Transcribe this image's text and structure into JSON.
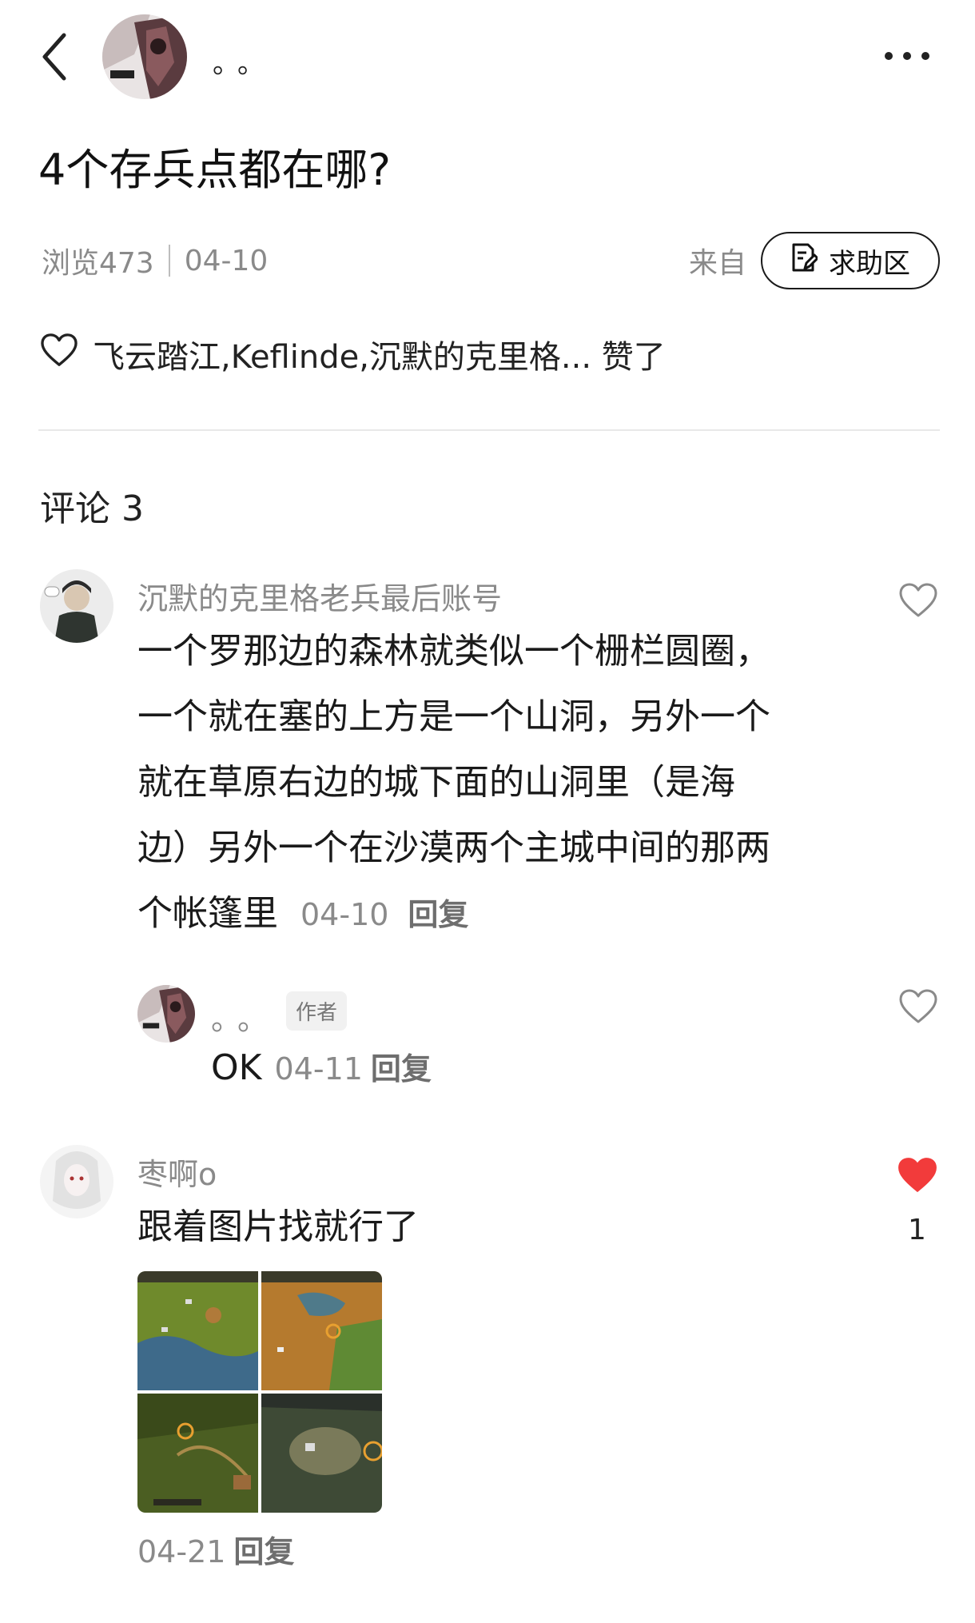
{
  "header": {
    "author_name": "。。"
  },
  "post": {
    "title": "4个存兵点都在哪?",
    "views": "浏览473",
    "date": "04-10",
    "from_label": "来自",
    "board": "求助区",
    "likes_text": "飞云踏江,Keflinde,沉默的克里格... 赞了"
  },
  "comments": {
    "title": "评论 3",
    "items": [
      {
        "name": "沉默的克里格老兵最后账号",
        "lines": [
          "一个罗那边的森林就类似一个栅栏圆圈，",
          "一个就在塞的上方是一个山洞，另外一个",
          "就在草原右边的城下面的山洞里（是海",
          "边）另外一个在沙漠两个主城中间的那两",
          "个帐篷里"
        ],
        "time": "04-10",
        "reply": "回复"
      },
      {
        "name": "。。",
        "badge": "作者",
        "text": "OK",
        "time": "04-11",
        "reply": "回复"
      },
      {
        "name": "枣啊o",
        "text": "跟着图片找就行了",
        "like_count": "1",
        "time": "04-21",
        "reply": "回复"
      }
    ]
  },
  "colors": {
    "heart_liked": "#f23b3b",
    "muted_text": "#8a8a8a"
  }
}
